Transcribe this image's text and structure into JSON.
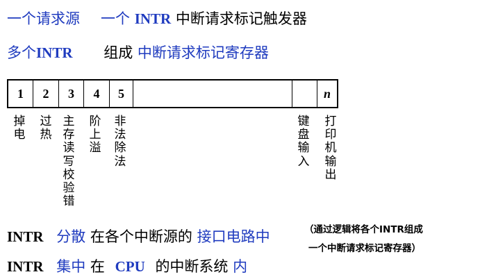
{
  "line1": {
    "p1": "一个请求源",
    "p2": "一个",
    "p3": "INTR",
    "p4": "中断请求标记触发器"
  },
  "line2": {
    "p1": "多个",
    "p2": "INTR",
    "p3": "组成",
    "p4": "中断请求标记寄存器"
  },
  "register": {
    "cells": [
      "1",
      "2",
      "3",
      "4",
      "5",
      "",
      "",
      "n"
    ]
  },
  "bit_labels": {
    "b1": "掉电",
    "b2": "过热",
    "b3": "主存读写校验错",
    "b4": "阶上溢",
    "b5": "非法除法",
    "b7": "键盘输入",
    "bn": "打印机输出"
  },
  "line3": {
    "p1": "INTR",
    "p2": "分散",
    "p3": "在各个中断源的",
    "p4": "接口电路中"
  },
  "note": {
    "l1": "（通过逻辑将各个INTR组成",
    "l2": "一个中断请求标记寄存器）"
  },
  "line4": {
    "p1": "INTR",
    "p2": "集中",
    "p3": "在",
    "p4": "CPU",
    "p5": "的中断系统",
    "p6": "内"
  },
  "colors": {
    "blue": "#1f3bbf",
    "black": "#000000"
  }
}
